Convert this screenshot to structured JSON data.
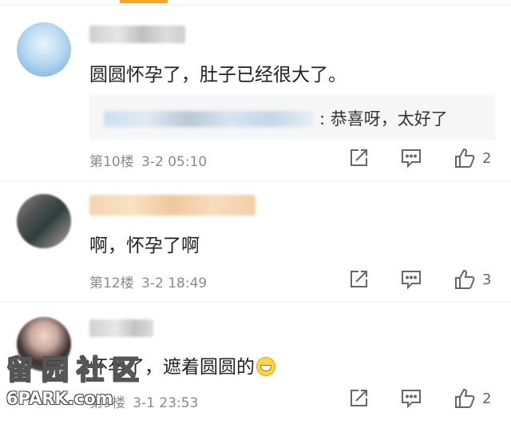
{
  "colors": {
    "accent": "#f5a623",
    "meta_text": "#8a8a8a",
    "content_text": "#1f1f1f"
  },
  "comments": [
    {
      "text": "圆圆怀孕了，肚子已经很大了。",
      "reply": {
        "text": ": 恭喜呀，太好了"
      },
      "floor": "第10楼",
      "time": "3-2 05:10",
      "likes": "2"
    },
    {
      "text": "啊，怀孕了啊",
      "floor": "第12楼",
      "time": "3-2 18:49",
      "likes": "3"
    },
    {
      "text": "怀孕了，遮着圆圆的",
      "emoji_icon": "grin-emoji-icon",
      "floor": "第9楼",
      "time": "3-1 23:53",
      "likes": "2"
    }
  ],
  "icons": {
    "share": "share-icon",
    "comment": "comment-icon",
    "like": "thumbs-up-icon"
  },
  "watermark": {
    "cn": "留园社区",
    "en": "6PARK.com"
  }
}
